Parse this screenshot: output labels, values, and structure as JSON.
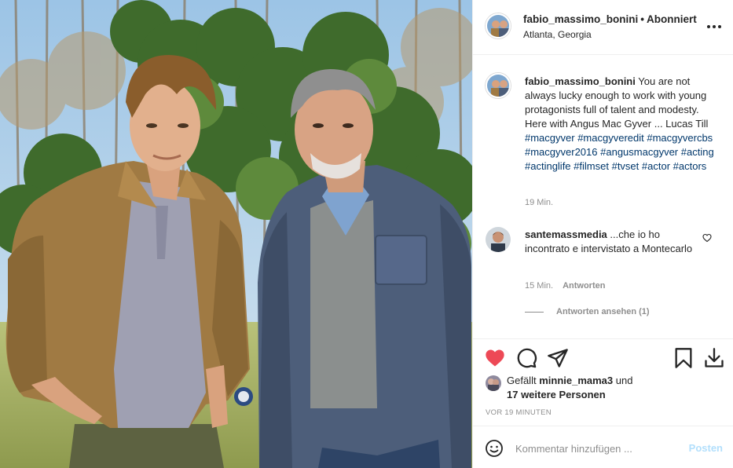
{
  "post": {
    "username": "fabio_massimo_bonini",
    "separator": "•",
    "follow_status": "Abonniert",
    "location": "Atlanta, Georgia",
    "photo_alt": "Two men standing outdoors on a film set"
  },
  "caption": {
    "username": "fabio_massimo_bonini",
    "text": "You are not always lucky enough to work with young protagonists full of talent and modesty. Here with Angus Mac Gyver ... Lucas Till",
    "hashtags": [
      "#macgyver",
      "#macgyveredit",
      "#macgyvercbs",
      "#macgyver2016",
      "#angusmacgyver",
      "#acting",
      "#actinglife",
      "#filmset",
      "#tvset",
      "#actor",
      "#actors"
    ],
    "time": "19 Min."
  },
  "comment": {
    "username": "santemassmedia",
    "text": "...che io ho incontrato e intervistato a Montecarlo",
    "time": "15 Min.",
    "reply_label": "Antworten",
    "view_replies": "Antworten ansehen (1)"
  },
  "likes": {
    "prefix": "Gefällt",
    "user": "minnie_mama3",
    "connector": "und",
    "others": "17 weitere Personen"
  },
  "timestamp": "VOR 19 MINUTEN",
  "composer": {
    "placeholder": "Kommentar hinzufügen ...",
    "post_label": "Posten"
  },
  "colors": {
    "heart_liked": "#ed4956",
    "hashtag": "#00376b",
    "post_button_disabled": "#b2dffc",
    "muted_text": "#8e8e8e"
  }
}
